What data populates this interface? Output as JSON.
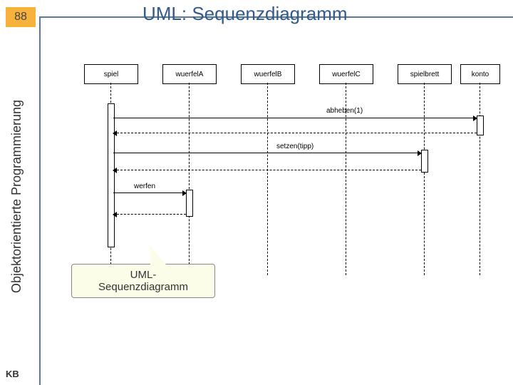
{
  "page_number": "88",
  "title": "UML: Sequenzdiagramm",
  "sidebar_label": "Objektorientierte Programmierung",
  "footer": "KB",
  "callout": "UML-\nSequenzdiagramm",
  "objects": [
    "spiel",
    "wuerfelA",
    "wuerfelB",
    "wuerfelC",
    "spielbrett",
    "konto"
  ],
  "messages": {
    "m1": "abheben(1)",
    "m2": "setzen(tipp)",
    "m3": "werfen"
  }
}
